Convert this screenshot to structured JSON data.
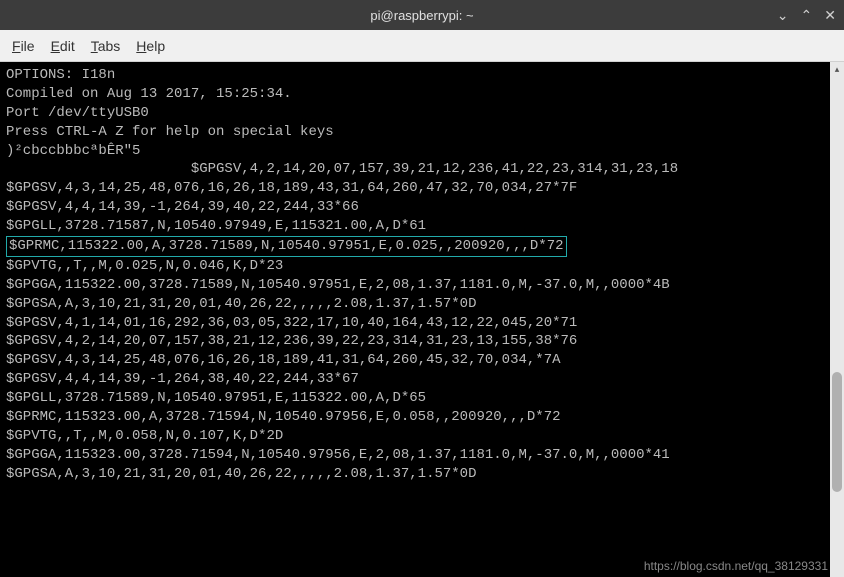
{
  "window": {
    "title": "pi@raspberrypi: ~"
  },
  "menubar": {
    "file": "File",
    "edit": "Edit",
    "tabs": "Tabs",
    "help": "Help"
  },
  "terminal": {
    "lines": [
      "OPTIONS: I18n",
      "Compiled on Aug 13 2017, 15:25:34.",
      "Port /dev/ttyUSB0",
      "",
      "Press CTRL-A Z for help on special keys",
      "",
      ")²cbccbbbcªbÊR\"5",
      "                      $GPGSV,4,2,14,20,07,157,39,21,12,236,41,22,23,314,31,23,18",
      "$GPGSV,4,3,14,25,48,076,16,26,18,189,43,31,64,260,47,32,70,034,27*7F",
      "$GPGSV,4,4,14,39,-1,264,39,40,22,244,33*66",
      "$GPGLL,3728.71587,N,10540.97949,E,115321.00,A,D*61"
    ],
    "highlighted_line": "$GPRMC,115322.00,A,3728.71589,N,10540.97951,E,0.025,,200920,,,D*72",
    "lines2": [
      "$GPVTG,,T,,M,0.025,N,0.046,K,D*23",
      "$GPGGA,115322.00,3728.71589,N,10540.97951,E,2,08,1.37,1181.0,M,-37.0,M,,0000*4B",
      "$GPGSA,A,3,10,21,31,20,01,40,26,22,,,,,2.08,1.37,1.57*0D",
      "$GPGSV,4,1,14,01,16,292,36,03,05,322,17,10,40,164,43,12,22,045,20*71",
      "$GPGSV,4,2,14,20,07,157,38,21,12,236,39,22,23,314,31,23,13,155,38*76",
      "$GPGSV,4,3,14,25,48,076,16,26,18,189,41,31,64,260,45,32,70,034,*7A",
      "$GPGSV,4,4,14,39,-1,264,38,40,22,244,33*67",
      "$GPGLL,3728.71589,N,10540.97951,E,115322.00,A,D*65",
      "$GPRMC,115323.00,A,3728.71594,N,10540.97956,E,0.058,,200920,,,D*72",
      "$GPVTG,,T,,M,0.058,N,0.107,K,D*2D",
      "$GPGGA,115323.00,3728.71594,N,10540.97956,E,2,08,1.37,1181.0,M,-37.0,M,,0000*41",
      "$GPGSA,A,3,10,21,31,20,01,40,26,22,,,,,2.08,1.37,1.57*0D"
    ]
  },
  "watermark": "https://blog.csdn.net/qq_38129331"
}
